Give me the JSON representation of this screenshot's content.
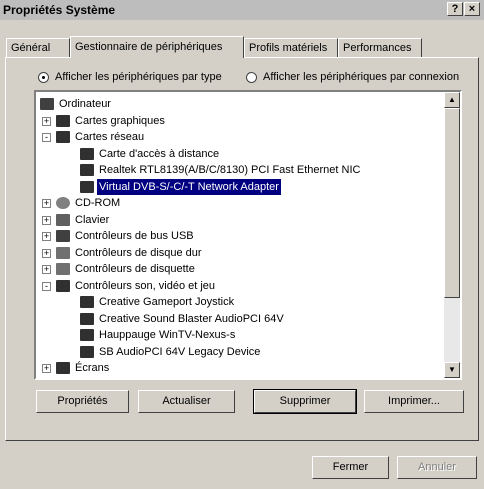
{
  "window": {
    "title": "Propriétés Système",
    "help_glyph": "?",
    "close_glyph": "×"
  },
  "tabs": [
    "Général",
    "Gestionnaire de périphériques",
    "Profils matériels",
    "Performances"
  ],
  "view_options": [
    {
      "label": "Afficher les périphériques par type",
      "selected": true
    },
    {
      "label": "Afficher les périphériques par connexion",
      "selected": false
    }
  ],
  "tree": [
    {
      "label": "Ordinateur",
      "icon": "computer-icon",
      "level": 0,
      "expander": ""
    },
    {
      "label": "Cartes graphiques",
      "icon": "monitor-icon",
      "level": 1,
      "expander": "+"
    },
    {
      "label": "Cartes réseau",
      "icon": "network-card-icon",
      "level": 1,
      "expander": "-"
    },
    {
      "label": "Carte d'accès à distance",
      "icon": "network-card-icon",
      "level": 2,
      "expander": ""
    },
    {
      "label": "Realtek RTL8139(A/B/C/8130) PCI Fast Ethernet NIC",
      "icon": "network-card-icon",
      "level": 2,
      "expander": ""
    },
    {
      "label": "Virtual DVB-S/-C/-T Network Adapter",
      "icon": "network-card-icon",
      "level": 2,
      "expander": "",
      "selected": true
    },
    {
      "label": "CD-ROM",
      "icon": "cdrom-icon",
      "level": 1,
      "expander": "+"
    },
    {
      "label": "Clavier",
      "icon": "keyboard-icon",
      "level": 1,
      "expander": "+"
    },
    {
      "label": "Contrôleurs de bus USB",
      "icon": "usb-icon",
      "level": 1,
      "expander": "+"
    },
    {
      "label": "Contrôleurs de disque dur",
      "icon": "harddisk-icon",
      "level": 1,
      "expander": "+"
    },
    {
      "label": "Contrôleurs de disquette",
      "icon": "floppy-icon",
      "level": 1,
      "expander": "+"
    },
    {
      "label": "Contrôleurs son, vidéo et jeu",
      "icon": "sound-icon",
      "level": 1,
      "expander": "-"
    },
    {
      "label": "Creative Gameport Joystick",
      "icon": "sound-icon",
      "level": 2,
      "expander": ""
    },
    {
      "label": "Creative Sound Blaster AudioPCI 64V",
      "icon": "sound-icon",
      "level": 2,
      "expander": ""
    },
    {
      "label": "Hauppauge WinTV-Nexus-s",
      "icon": "sound-icon",
      "level": 2,
      "expander": ""
    },
    {
      "label": "SB AudioPCI 64V Legacy Device",
      "icon": "sound-icon",
      "level": 2,
      "expander": ""
    },
    {
      "label": "Écrans",
      "icon": "monitor-icon",
      "level": 1,
      "expander": "+"
    }
  ],
  "actions": [
    "Propriétés",
    "Actualiser",
    "Supprimer",
    "Imprimer..."
  ],
  "footer": {
    "ok": "Fermer",
    "cancel": "Annuler"
  }
}
